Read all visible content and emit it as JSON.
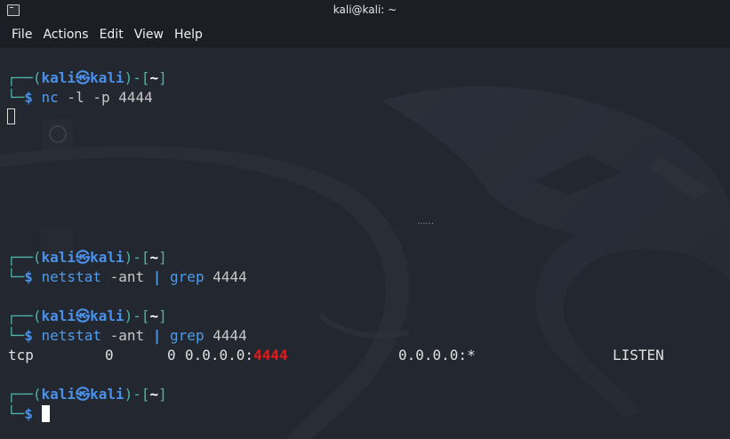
{
  "window": {
    "title": "kali@kali: ~"
  },
  "menu": [
    "File",
    "Actions",
    "Edit",
    "View",
    "Help"
  ],
  "prompt": {
    "corner_top": "┌──(",
    "user": "kali",
    "at": "㉿",
    "host": "kali",
    "mid": ")-[",
    "dir": "~",
    "end": "]",
    "corner_bottom": "└─",
    "dollar": "$ "
  },
  "blocks": [
    {
      "command": "nc",
      "args": " -l -p 4444"
    },
    {
      "command": "netstat",
      "args": " -ant ",
      "pipe": "|",
      "command2": " grep",
      "args2": " 4444"
    },
    {
      "command": "netstat",
      "args": " -ant ",
      "pipe": "|",
      "command2": " grep",
      "args2": " 4444"
    }
  ],
  "output_row": {
    "proto": "tcp",
    "recvq": "0",
    "sendq": "0",
    "local_addr": "0.0.0.0:",
    "local_port": "4444",
    "foreign_addr": "0.0.0.0:*",
    "state": "LISTEN"
  },
  "desktop_hint": "......",
  "colors": {
    "prompt_frame": "#4cb5a8",
    "prompt_user": "#4a90e8",
    "highlight_port": "#e51a1a"
  }
}
